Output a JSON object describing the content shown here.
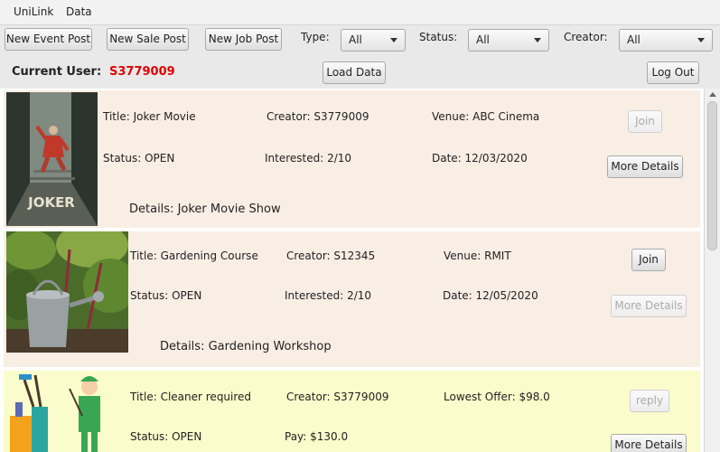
{
  "menu": {
    "items": [
      "UniLink",
      "Data"
    ]
  },
  "toolbar": {
    "new_event": "New Event Post",
    "new_sale": "New Sale Post",
    "new_job": "New Job Post",
    "type_label": "Type:",
    "type_value": "All",
    "status_label": "Status:",
    "status_value": "All",
    "creator_label": "Creator:",
    "creator_value": "All"
  },
  "user": {
    "label": "Current User:",
    "id": "S3779009",
    "load_data": "Load Data",
    "logout": "Log Out"
  },
  "posts": [
    {
      "title": "Title: Joker Movie",
      "creator": "Creator: S3779009",
      "extra": "Venue: ABC Cinema",
      "status": "Status: OPEN",
      "count": "Interested: 2/10",
      "date": "Date: 12/03/2020",
      "details": "Details: Joker Movie Show",
      "action": "Join",
      "more": "More Details",
      "image_label": "JOKER"
    },
    {
      "title": "Title: Gardening Course",
      "creator": "Creator: S12345",
      "extra": "Venue: RMIT",
      "status": "Status: OPEN",
      "count": "Interested: 2/10",
      "date": "Date: 12/05/2020",
      "details": "Details: Gardening Workshop",
      "action": "Join",
      "more": "More Details"
    },
    {
      "title": "Title: Cleaner required",
      "creator": "Creator: S3779009",
      "extra": "Lowest Offer: $98.0",
      "status": "Status: OPEN",
      "count": "Pay: $130.0",
      "action": "reply",
      "more": "More Details"
    }
  ],
  "colors": {
    "accent_user": "#e00000",
    "event_bg": "#f9eee4",
    "job_bg": "#fbfccb"
  }
}
